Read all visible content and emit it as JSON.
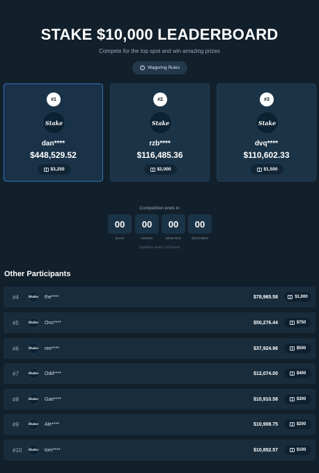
{
  "header": {
    "title": "STAKE $10,000 LEADERBOARD",
    "subtitle": "Compete for the top spot and win amazing prizes",
    "rules_button": "Wagering Rules"
  },
  "podium": [
    {
      "rank": "#1",
      "logo": "Stake",
      "name": "dan****",
      "amount": "$448,529.52",
      "prize": "$3,250"
    },
    {
      "rank": "#2",
      "logo": "Stake",
      "name": "rzb****",
      "amount": "$116,485.36",
      "prize": "$2,000"
    },
    {
      "rank": "#3",
      "logo": "Stake",
      "name": "dvq****",
      "amount": "$110,602.33",
      "prize": "$1,500"
    }
  ],
  "countdown": {
    "label": "Competition ends in",
    "units": [
      {
        "value": "00",
        "label": "DAYS"
      },
      {
        "value": "00",
        "label": "HOURS"
      },
      {
        "value": "00",
        "label": "MINUTES"
      },
      {
        "value": "00",
        "label": "SECONDS"
      }
    ],
    "note": "Updates every 24 hours"
  },
  "others": {
    "title": "Other Participants",
    "rows": [
      {
        "rank": "#4",
        "logo": "Stake",
        "name": "the****",
        "amount": "$78,965.58",
        "prize": "$1,000"
      },
      {
        "rank": "#5",
        "logo": "Stake",
        "name": "Ons****",
        "amount": "$50,276.44",
        "prize": "$750"
      },
      {
        "rank": "#6",
        "logo": "Stake",
        "name": "ree****",
        "amount": "$37,924.96",
        "prize": "$500"
      },
      {
        "rank": "#7",
        "logo": "Stake",
        "name": "Odd****",
        "amount": "$12,074.00",
        "prize": "$400"
      },
      {
        "rank": "#8",
        "logo": "Stake",
        "name": "Gae****",
        "amount": "$10,910.58",
        "prize": "$300"
      },
      {
        "rank": "#9",
        "logo": "Stake",
        "name": "Ale****",
        "amount": "$10,908.75",
        "prize": "$200"
      },
      {
        "rank": "#10",
        "logo": "Stake",
        "name": "tom****",
        "amount": "$10,852.57",
        "prize": "$100"
      }
    ]
  },
  "colors": {
    "background": "#12202c",
    "card": "#1b3346",
    "first_place_border": "#2f71b4",
    "row": "#182c3c"
  },
  "icons": {
    "rules": "info-icon",
    "prize": "gift-icon"
  }
}
